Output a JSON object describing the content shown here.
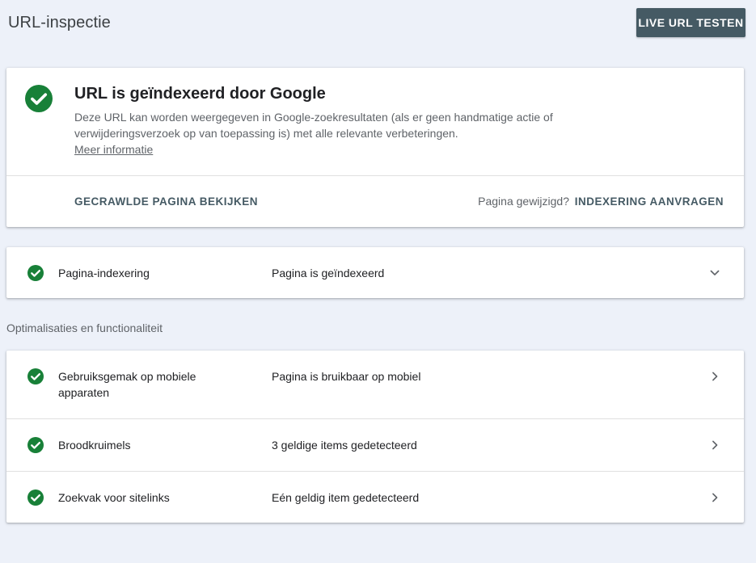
{
  "header": {
    "title": "URL-inspectie",
    "live_test_label": "LIVE URL TESTEN"
  },
  "status": {
    "heading": "URL is geïndexeerd door Google",
    "description": "Deze URL kan worden weergegeven in Google-zoekresultaten (als er geen handmatige actie of verwijderingsverzoek op van toepassing is) met alle relevante verbeteringen.",
    "more_info": "Meer informatie",
    "crawled_page_label": "GECRAWLDE PAGINA BEKIJKEN",
    "page_changed_text": "Pagina gewijzigd?",
    "request_indexing_label": "INDEXERING AANVRAGEN"
  },
  "indexing": {
    "label": "Pagina-indexering",
    "value": "Pagina is geïndexeerd"
  },
  "enhancements": {
    "section_title": "Optimalisaties en functionaliteit",
    "items": [
      {
        "label": "Gebruiksgemak op mobiele apparaten",
        "value": "Pagina is bruikbaar op mobiel"
      },
      {
        "label": "Broodkruimels",
        "value": "3 geldige items gedetecteerd"
      },
      {
        "label": "Zoekvak voor sitelinks",
        "value": "Eén geldig item gedetecteerd"
      }
    ]
  },
  "colors": {
    "success_green": "#188038",
    "button_dark": "#455a64",
    "background": "#edf1f9"
  },
  "icons": {
    "status": "check-circle-icon",
    "expand": "chevron-down-icon",
    "open": "chevron-right-icon"
  }
}
